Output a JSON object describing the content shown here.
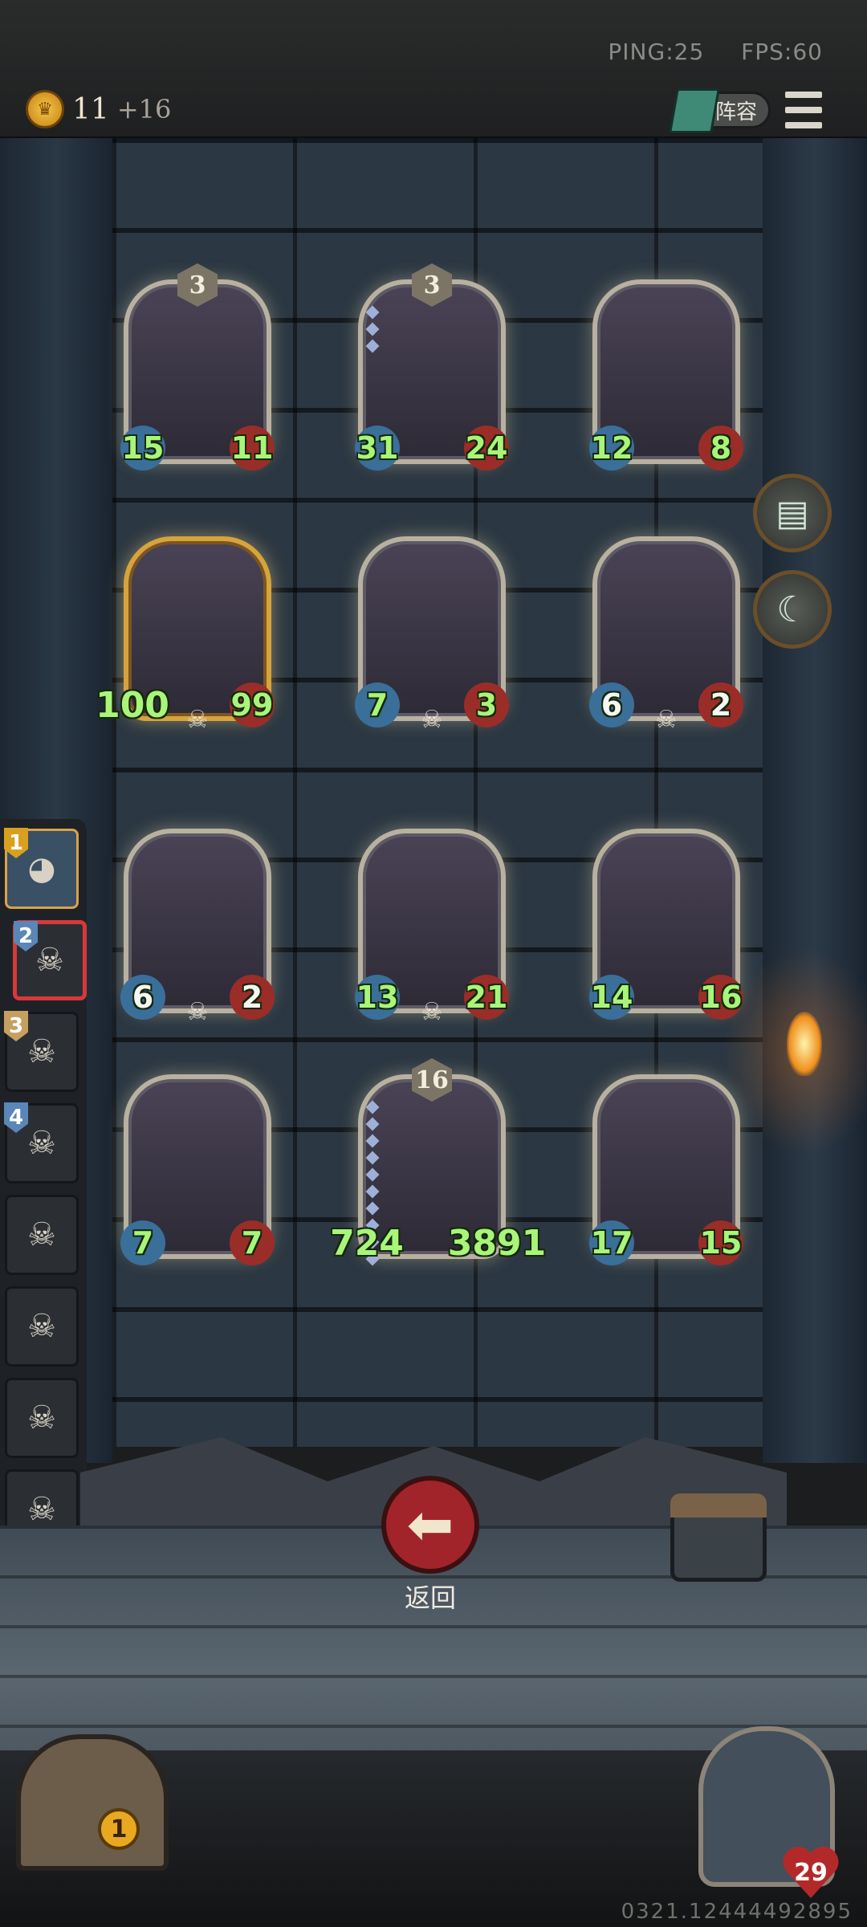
{
  "top_bar": {
    "ping": "PING:25",
    "fps": "FPS:60",
    "gold": "11",
    "gold_income": "+16",
    "lineup_label": "阵容"
  },
  "board": {
    "cards": [
      {
        "id": "c1",
        "stars": "3",
        "attack": "15",
        "health": "11",
        "skull": false,
        "gold": false,
        "chain": false
      },
      {
        "id": "c2",
        "stars": "3",
        "attack": "31",
        "health": "24",
        "skull": false,
        "gold": false,
        "chain": true
      },
      {
        "id": "c3",
        "stars": "",
        "attack": "12",
        "health": "8",
        "skull": false,
        "gold": false,
        "chain": false
      },
      {
        "id": "c4",
        "stars": "",
        "attack": "100",
        "health": "99",
        "skull": true,
        "gold": true,
        "chain": false
      },
      {
        "id": "c5",
        "stars": "",
        "attack": "7",
        "health": "3",
        "skull": true,
        "gold": false,
        "chain": false
      },
      {
        "id": "c6",
        "stars": "",
        "attack": "6",
        "health": "2",
        "skull": true,
        "gold": false,
        "chain": false
      },
      {
        "id": "c7",
        "stars": "",
        "attack": "6",
        "health": "2",
        "skull": true,
        "gold": false,
        "chain": false
      },
      {
        "id": "c8",
        "stars": "",
        "attack": "13",
        "health": "21",
        "skull": true,
        "gold": false,
        "chain": false
      },
      {
        "id": "c9",
        "stars": "",
        "attack": "14",
        "health": "16",
        "skull": false,
        "gold": false,
        "chain": false
      },
      {
        "id": "c10",
        "stars": "",
        "attack": "7",
        "health": "7",
        "skull": false,
        "gold": false,
        "chain": false
      },
      {
        "id": "c11",
        "stars": "16",
        "attack": "724",
        "health": "3891",
        "skull": false,
        "gold": false,
        "chain": true
      },
      {
        "id": "c12",
        "stars": "",
        "attack": "17",
        "health": "15",
        "skull": false,
        "gold": false,
        "chain": false
      }
    ]
  },
  "side_list": {
    "slots": [
      {
        "rank": "1",
        "state": "selected",
        "rank_color": "#d9a020"
      },
      {
        "rank": "2",
        "state": "red",
        "rank_color": "#5a86b8"
      },
      {
        "rank": "3",
        "state": "dead",
        "rank_color": "#c6a060"
      },
      {
        "rank": "4",
        "state": "dead",
        "rank_color": "#5a86b8"
      },
      {
        "rank": "",
        "state": "dead",
        "rank_color": ""
      },
      {
        "rank": "",
        "state": "dead",
        "rank_color": ""
      },
      {
        "rank": "",
        "state": "dead",
        "rank_color": ""
      },
      {
        "rank": "",
        "state": "dead",
        "rank_color": ""
      }
    ]
  },
  "back_button": {
    "label": "返回"
  },
  "door": {
    "count": "1"
  },
  "hero": {
    "health": "29"
  },
  "build_id": "0321.12444492895",
  "colors": {
    "attack_badge": "#3a6f9a",
    "health_badge": "#9a2d28",
    "stat_text": "#a8f57a",
    "back_button": "#a1242a"
  }
}
